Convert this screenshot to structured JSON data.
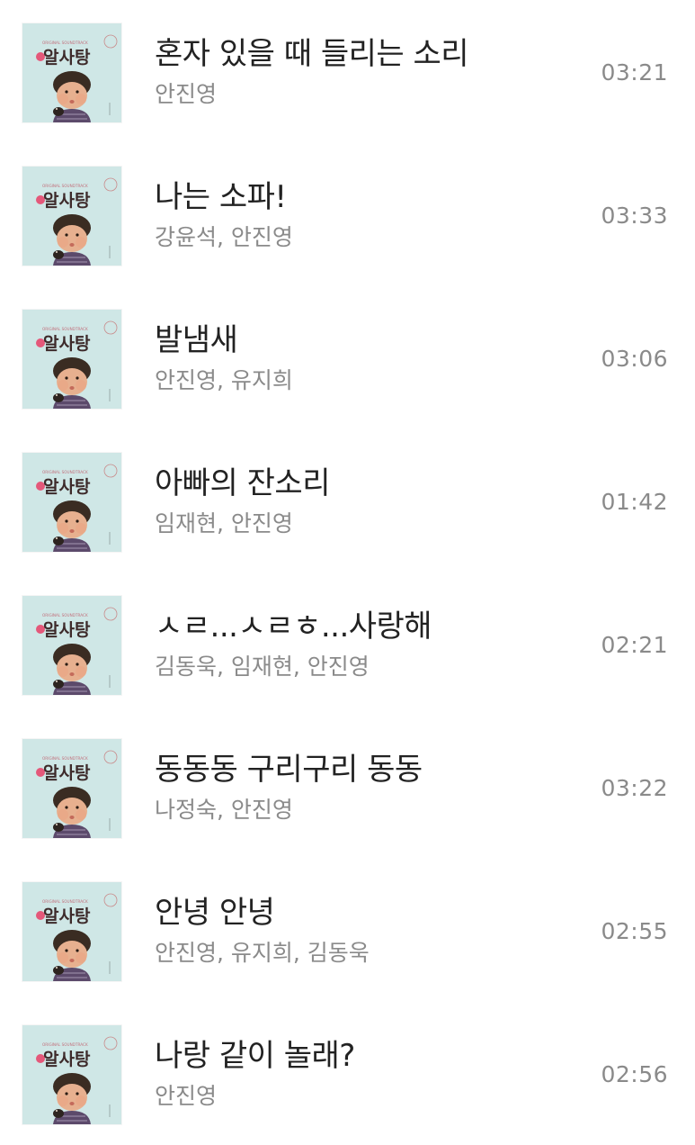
{
  "album_art": {
    "icon": "album-cover-art",
    "top_text": "ORIGINAL SOUNDTRACK",
    "title_text": "알사탕",
    "background_color": "#cfe7e6"
  },
  "tracks": [
    {
      "title": "혼자 있을 때 들리는 소리",
      "artist": "안진영",
      "duration": "03:21"
    },
    {
      "title": "나는 소파!",
      "artist": "강윤석, 안진영",
      "duration": "03:33"
    },
    {
      "title": "발냄새",
      "artist": "안진영, 유지희",
      "duration": "03:06"
    },
    {
      "title": "아빠의 잔소리",
      "artist": "임재현, 안진영",
      "duration": "01:42"
    },
    {
      "title": "ㅅㄹ...ㅅㄹㅎ...사랑해",
      "artist": "김동욱, 임재현, 안진영",
      "duration": "02:21"
    },
    {
      "title": "동동동 구리구리 동동",
      "artist": "나정숙, 안진영",
      "duration": "03:22"
    },
    {
      "title": "안녕 안녕",
      "artist": "안진영, 유지희, 김동욱",
      "duration": "02:55"
    },
    {
      "title": "나랑 같이 놀래?",
      "artist": "안진영",
      "duration": "02:56"
    }
  ]
}
